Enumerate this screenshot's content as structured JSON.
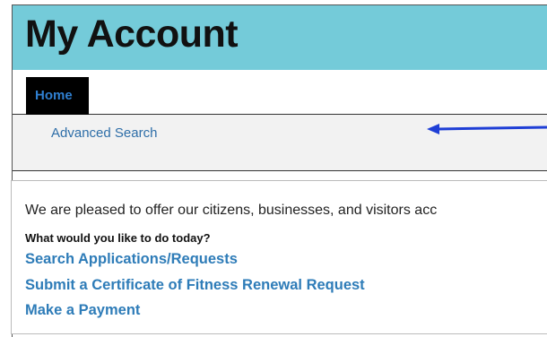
{
  "header": {
    "title": "My Account"
  },
  "nav": {
    "home_tab": "Home",
    "advanced_search": "Advanced Search"
  },
  "content": {
    "intro": "We are pleased to offer our citizens, businesses, and visitors acc",
    "question": "What would you like to do today?",
    "links": [
      "Search Applications/Requests",
      "Submit a Certificate of Fitness Renewal Request",
      "Make a Payment"
    ]
  },
  "annotation": {
    "arrow_color": "#1f3fd6"
  },
  "colors": {
    "header_bg": "#74cbd9",
    "link": "#2e7cb8",
    "tab_bg": "#000000"
  }
}
